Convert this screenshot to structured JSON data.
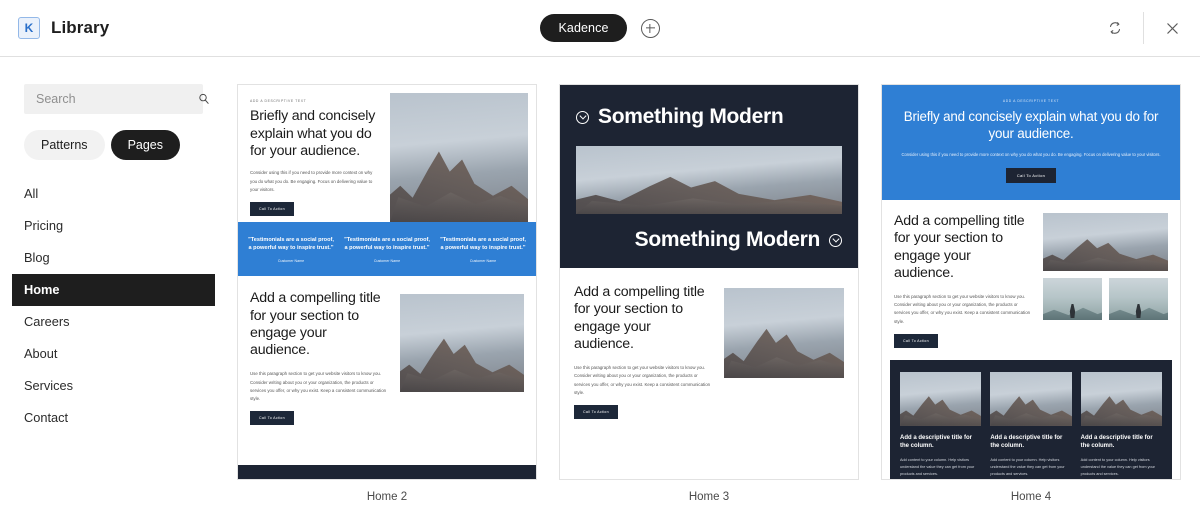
{
  "header": {
    "brand_logo": "kadence-k-logo",
    "brand_logo_glyph": "K",
    "title": "Library",
    "center_pill_label": "Kadence",
    "add_icon": "plus-circle-icon",
    "refresh_icon": "refresh-icon",
    "close_icon": "close-icon"
  },
  "sidebar": {
    "search": {
      "value": "",
      "placeholder": "Search",
      "icon": "search-icon"
    },
    "segments": [
      {
        "label": "Patterns",
        "active": false
      },
      {
        "label": "Pages",
        "active": true
      }
    ],
    "nav": [
      {
        "label": "All",
        "active": false
      },
      {
        "label": "Pricing",
        "active": false
      },
      {
        "label": "Blog",
        "active": false
      },
      {
        "label": "Home",
        "active": true
      },
      {
        "label": "Careers",
        "active": false
      },
      {
        "label": "About",
        "active": false
      },
      {
        "label": "Services",
        "active": false
      },
      {
        "label": "Contact",
        "active": false
      }
    ]
  },
  "common": {
    "eyebrow": "ADD A DESCRIPTIVE TEXT",
    "hero_heading": "Briefly and concisely explain what you do for your audience.",
    "hero_body": "Consider using this if you need to provide more context on why you do what you do. Be engaging. Focus on delivering value to your visitors.",
    "section_heading": "Add a compelling title for your section to engage your audience.",
    "section_body": "Use this paragraph section to get your website visitors to know you. Consider writing about you or your organization, the products or services you offer, or why you exist. Keep a consistent communication style.",
    "cta_label": "Call To Action",
    "photo_alt": "mountain-photo"
  },
  "cards": [
    {
      "label": "Home 2",
      "testimonials": [
        {
          "quote": "\"Testimonials are a social proof, a powerful way to inspire trust.\"",
          "name": "Customer Name"
        },
        {
          "quote": "\"Testimonials are a social proof, a powerful way to inspire trust.\"",
          "name": "Customer Name"
        },
        {
          "quote": "\"Testimonials are a social proof, a powerful way to inspire trust.\"",
          "name": "Customer Name"
        }
      ]
    },
    {
      "label": "Home 3",
      "modern_title_top": "Something Modern",
      "modern_title_bottom": "Something Modern",
      "modern_icon": "circle-arrow-down-icon"
    },
    {
      "label": "Home 4",
      "columns": [
        {
          "title": "Add a descriptive title for the column.",
          "body": "Add content to your column. Help visitors understand the value they can get from your products and services."
        },
        {
          "title": "Add a descriptive title for the column.",
          "body": "Add content to your column. Help visitors understand the value they can get from your products and services."
        },
        {
          "title": "Add a descriptive title for the column.",
          "body": "Add content to your column. Help visitors understand the value they can get from your products and services."
        }
      ]
    }
  ],
  "colors": {
    "accent_blue": "#2f7fd4",
    "dark_navy": "#1d2433",
    "ink": "#1e1e1e",
    "panel_grey": "#f0f0f0"
  }
}
